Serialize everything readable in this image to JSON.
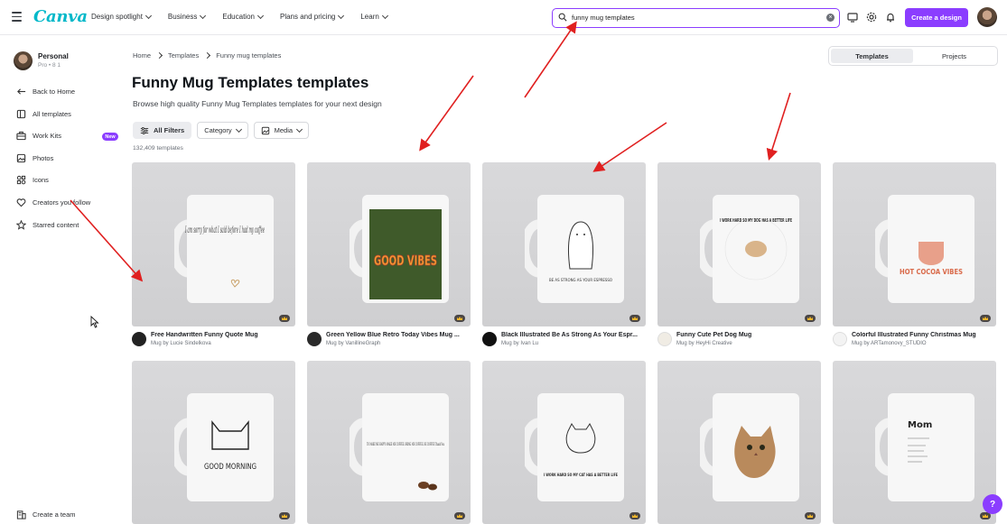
{
  "header": {
    "logo": "Canva",
    "nav": [
      "Design spotlight",
      "Business",
      "Education",
      "Plans and pricing",
      "Learn"
    ],
    "search_value": "funny mug templates",
    "search_clear": "×",
    "create_label": "Create a design"
  },
  "sidebar": {
    "account_name": "Personal",
    "account_sub": "Pro • 8 1",
    "items": [
      {
        "label": "Back to Home",
        "icon": "back-arrow-icon"
      },
      {
        "label": "All templates",
        "icon": "templates-icon"
      },
      {
        "label": "Work Kits",
        "icon": "briefcase-icon",
        "badge": "New"
      },
      {
        "label": "Photos",
        "icon": "photo-icon"
      },
      {
        "label": "Icons",
        "icon": "shapes-icon"
      },
      {
        "label": "Creators you follow",
        "icon": "heart-icon"
      },
      {
        "label": "Starred content",
        "icon": "star-icon"
      }
    ],
    "create_team": "Create a team"
  },
  "breadcrumb": [
    "Home",
    "Templates",
    "Funny mug templates"
  ],
  "view_toggle": {
    "templates": "Templates",
    "projects": "Projects",
    "active": "templates"
  },
  "page": {
    "title": "Funny Mug Templates templates",
    "subtitle": "Browse high quality Funny Mug Templates templates for your next design",
    "count": "132,409 templates"
  },
  "filters": {
    "all": "All Filters",
    "category": "Category",
    "media": "Media"
  },
  "templates_row1": [
    {
      "title": "Free Handwritten Funny Quote Mug",
      "author": "Mug by Lucie Sindelkova",
      "art": "I am sorry for what I said before I had my coffee"
    },
    {
      "title": "Green Yellow Blue Retro Today Vibes Mug ...",
      "author": "Mug by VanillineGraph",
      "art": "GOOD VIBES"
    },
    {
      "title": "Black Illustrated Be As Strong As Your Espr...",
      "author": "Mug by Ivan Lu",
      "art": "BE AS STRONG AS YOUR ESPRESSO"
    },
    {
      "title": "Funny Cute Pet Dog Mug",
      "author": "Mug by HeyHi Creative",
      "art": "I WORK HARD SO MY DOG HAS A BETTER LIFE"
    },
    {
      "title": "Colorful Illustrated Funny Christmas Mug",
      "author": "Mug by ARTamonovy_STUDIO",
      "art": "HOT COCOA VIBES"
    }
  ],
  "templates_row2": [
    {
      "art": "GOOD MORNING"
    },
    {
      "art": "TO MAKE ME HAPPY: MAKE ME COFFEE. BRING ME COFFEE. BE COFFEE Thank You"
    },
    {
      "art": "I WORK HARD SO MY CAT HAS A BETTER LIFE"
    },
    {
      "art": ""
    },
    {
      "art": "Mom"
    }
  ],
  "help_label": "?"
}
